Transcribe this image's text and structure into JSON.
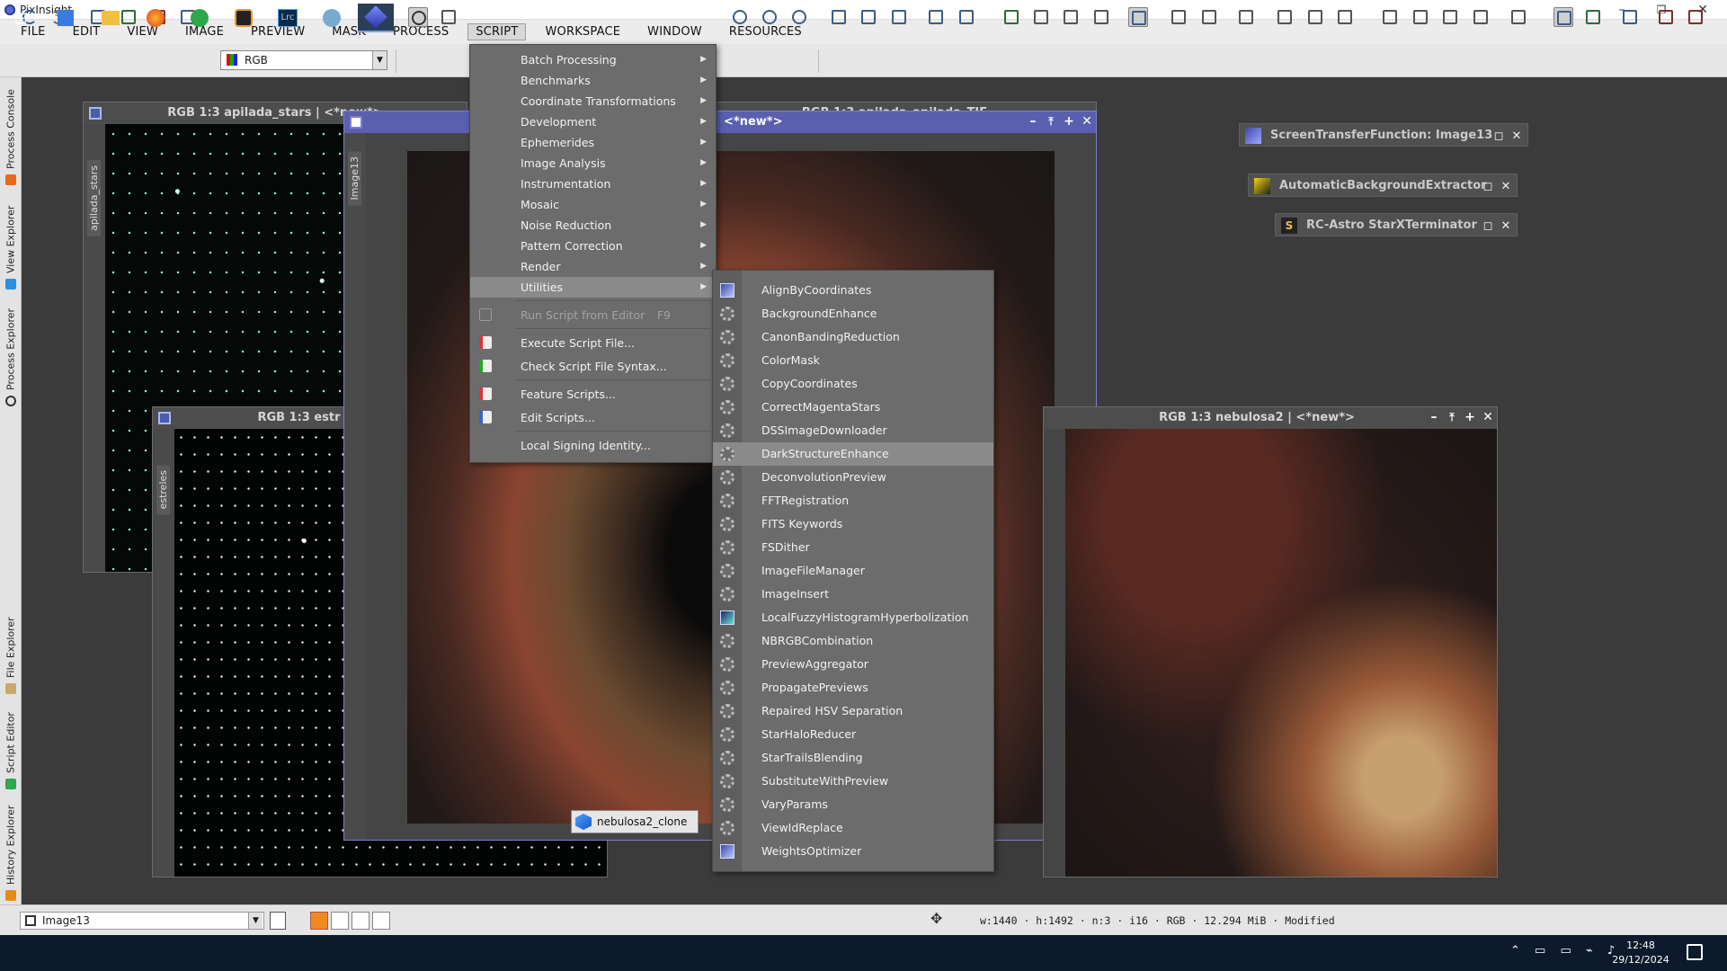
{
  "app": {
    "title": "PixInsight",
    "window_controls": [
      "–",
      "❐",
      "✕"
    ]
  },
  "menubar": {
    "items": [
      "FILE",
      "EDIT",
      "VIEW",
      "IMAGE",
      "PREVIEW",
      "MASK",
      "PROCESS",
      "SCRIPT",
      "WORKSPACE",
      "WINDOW",
      "RESOURCES"
    ],
    "active": "SCRIPT"
  },
  "toolbar": {
    "rgb_combo": "RGB",
    "combo_arrow": "▼"
  },
  "left_tabs": [
    "Process Console",
    "View Explorer",
    "Process Explorer",
    "File Explorer",
    "Script Editor",
    "History Explorer"
  ],
  "windows": {
    "apilada_stars": {
      "title": "RGB 1:3 apilada_stars | <*new*>",
      "side": "apilada_stars"
    },
    "estreles": {
      "title": "RGB 1:3 estr",
      "side": "estreles"
    },
    "image13": {
      "title": "<*new*>",
      "side": "Image13"
    },
    "behind": {
      "title": "RGB 1:3 apilada_apilada_TIF"
    },
    "nebulosa2": {
      "title": "RGB 1:3 nebulosa2 | <*new*>"
    }
  },
  "window_buttons": [
    "–",
    "⤒",
    "+",
    "✕"
  ],
  "process_icons": [
    {
      "label": "ScreenTransferFunction: Image13"
    },
    {
      "label": "AutomaticBackgroundExtractor"
    },
    {
      "label": "RC-Astro StarXTerminator"
    }
  ],
  "script_menu": {
    "categories": [
      "Batch Processing",
      "Benchmarks",
      "Coordinate Transformations",
      "Development",
      "Ephemerides",
      "Image Analysis",
      "Instrumentation",
      "Mosaic",
      "Noise Reduction",
      "Pattern Correction",
      "Render",
      "Utilities"
    ],
    "selected": "Utilities",
    "arrow": "▶",
    "run_from_editor": "Run Script from Editor",
    "run_key": "F9",
    "execute": "Execute Script File...",
    "check": "Check Script File Syntax...",
    "feature": "Feature Scripts...",
    "edit": "Edit Scripts...",
    "signing": "Local Signing Identity..."
  },
  "utilities_menu": {
    "items": [
      "AlignByCoordinates",
      "BackgroundEnhance",
      "CanonBandingReduction",
      "ColorMask",
      "CopyCoordinates",
      "CorrectMagentaStars",
      "DSSImageDownloader",
      "DarkStructureEnhance",
      "DeconvolutionPreview",
      "FFTRegistration",
      "FITS Keywords",
      "FSDither",
      "ImageFileManager",
      "ImageInsert",
      "LocalFuzzyHistogramHyperbolization",
      "NBRGBCombination",
      "PreviewAggregator",
      "PropagatePreviews",
      "Repaired HSV Separation",
      "StarHaloReducer",
      "StarTrailsBlending",
      "SubstituteWithPreview",
      "VaryParams",
      "ViewIdReplace",
      "WeightsOptimizer"
    ],
    "selected": "DarkStructureEnhance",
    "icon_items": [
      "AlignByCoordinates",
      "LocalFuzzyHistogramHyperbolization",
      "WeightsOptimizer"
    ]
  },
  "clone_tab": "nebulosa2_clone",
  "statusbar": {
    "view": "Image13",
    "info": "w:1440 · h:1492 · n:3 · i16 · RGB · 12.294 MiB · Modified"
  },
  "taskbar": {
    "time": "12:48",
    "date": "29/12/2024"
  },
  "colors": {
    "menu_bg": "#6c6c6c",
    "selected": "#8a8a8a",
    "active_header": "#5a5fb0"
  }
}
